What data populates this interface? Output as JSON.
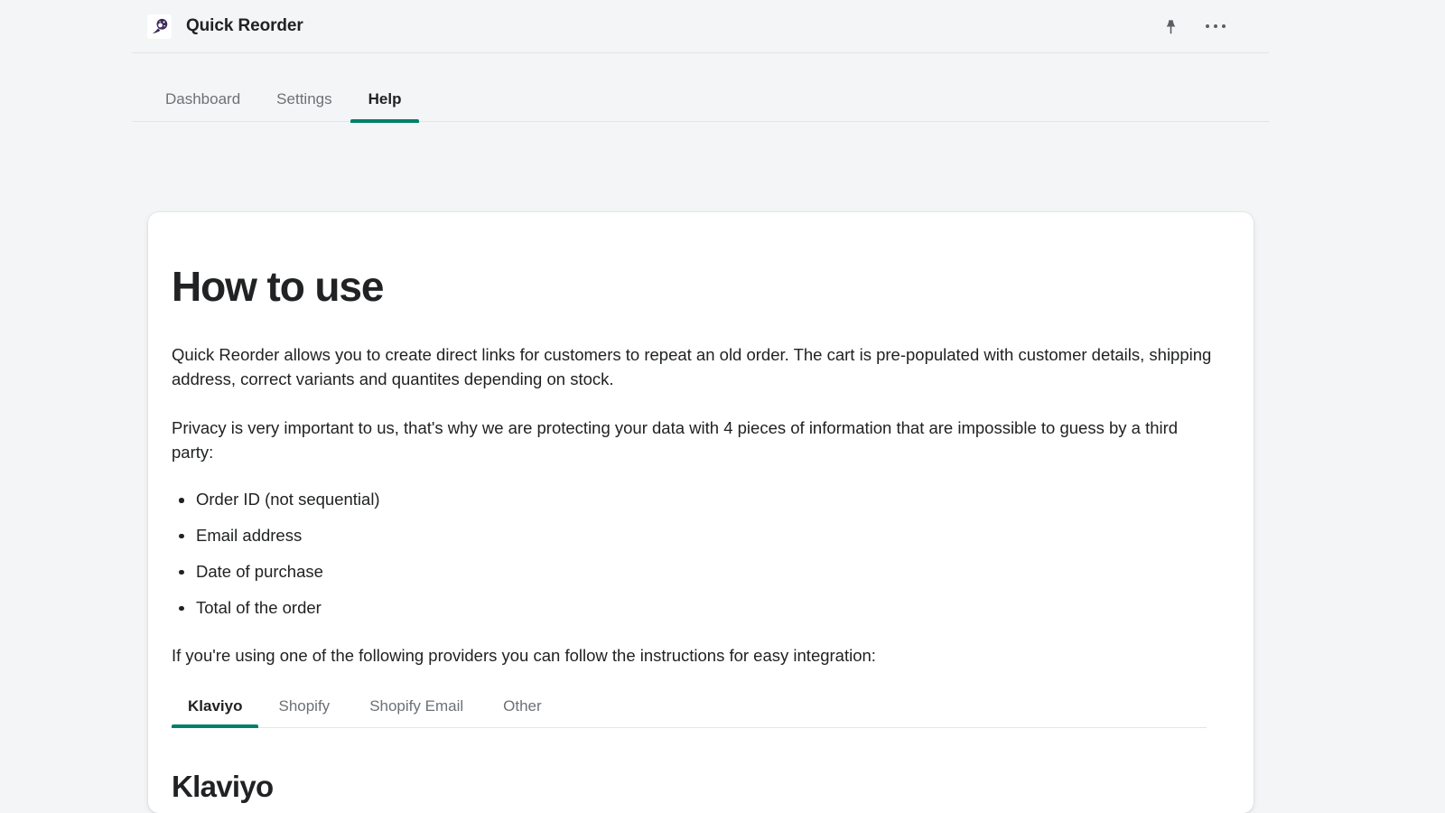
{
  "window": {
    "app_title": "Quick Reorder",
    "app_icon": "comet-bird-logo-icon",
    "actions": [
      {
        "name": "pin-icon",
        "label": "Pin"
      },
      {
        "name": "more-options-icon",
        "label": "More options"
      }
    ]
  },
  "nav": {
    "tabs": [
      {
        "label": "Dashboard",
        "active": false
      },
      {
        "label": "Settings",
        "active": false
      },
      {
        "label": "Help",
        "active": true
      }
    ],
    "active_index": 2
  },
  "page": {
    "title": "How to use",
    "paragraphs": [
      "Quick Reorder allows you to create direct links for customers to repeat an old order. The cart is pre-populated with customer details, shipping address, correct variants and quantites depending on stock.",
      "Privacy is very important to us, that's why we are protecting your data with 4 pieces of information that are impossible to guess by a third party:"
    ],
    "bullets": [
      "Order ID (not sequential)",
      "Email address",
      "Date of purchase",
      "Total of the order"
    ],
    "providers_intro": "If you're using one of the following providers you can follow the instructions for easy integration:",
    "provider_tabs": [
      {
        "label": "Klaviyo",
        "active": true
      },
      {
        "label": "Shopify",
        "active": false
      },
      {
        "label": "Shopify Email",
        "active": false
      },
      {
        "label": "Other",
        "active": false
      }
    ],
    "provider_section_title": "Klaviyo"
  },
  "theme": {
    "accent": "#00806b",
    "page_background": "#f4f5f6",
    "card_background": "#ffffff",
    "text_primary": "#202223",
    "text_secondary": "#6d7175",
    "border": "#e3e4e6"
  }
}
